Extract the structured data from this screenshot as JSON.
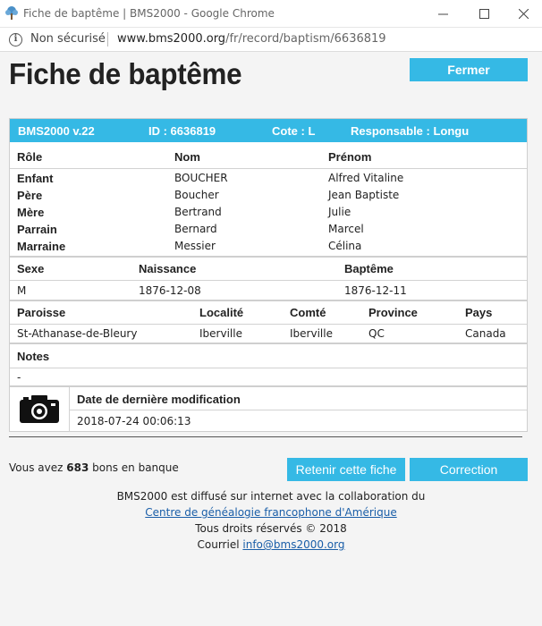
{
  "browser": {
    "window_title": "Fiche de baptême | BMS2000 - Google Chrome",
    "security_label": "Non sécurisé",
    "url_host": "www.bms2000.org",
    "url_path": "/fr/record/baptism/6636819"
  },
  "page": {
    "title": "Fiche de baptême",
    "close_label": "Fermer"
  },
  "record_header": {
    "version": "BMS2000 v.22",
    "id": "ID : 6636819",
    "cote": "Cote : L",
    "responsable": "Responsable : Longu"
  },
  "persons": {
    "headers": [
      "Rôle",
      "Nom",
      "Prénom"
    ],
    "rows": [
      {
        "role": "Enfant",
        "nom": "BOUCHER",
        "prenom": "Alfred Vitaline"
      },
      {
        "role": "Père",
        "nom": "Boucher",
        "prenom": "Jean Baptiste"
      },
      {
        "role": "Mère",
        "nom": "Bertrand",
        "prenom": "Julie"
      },
      {
        "role": "Parrain",
        "nom": "Bernard",
        "prenom": "Marcel"
      },
      {
        "role": "Marraine",
        "nom": "Messier",
        "prenom": "Célina"
      }
    ]
  },
  "vitals": {
    "headers": [
      "Sexe",
      "Naissance",
      "Baptême"
    ],
    "values": [
      "M",
      "1876-12-08",
      "1876-12-11"
    ]
  },
  "place": {
    "headers": [
      "Paroisse",
      "Localité",
      "Comté",
      "Province",
      "Pays"
    ],
    "values": [
      "St-Athanase-de-Bleury",
      "Iberville",
      "Iberville",
      "QC",
      "Canada"
    ]
  },
  "notes": {
    "label": "Notes",
    "value": "-"
  },
  "modification": {
    "label": "Date de dernière modification",
    "value": "2018-07-24 00:06:13",
    "icon": "camera-icon"
  },
  "bank": {
    "prefix": "Vous avez",
    "count": "683",
    "suffix": "bons en banque"
  },
  "actions": {
    "retain_label": "Retenir cette fiche",
    "correction_label": "Correction"
  },
  "footer": {
    "line1": "BMS2000 est diffusé sur internet avec la collaboration du",
    "link": "Centre de généalogie francophone d'Amérique",
    "rights": "Tous droits réservés © 2018",
    "contact_prefix": "Courriel",
    "email": "info@bms2000.org"
  },
  "colors": {
    "accent": "#35b9e5"
  }
}
